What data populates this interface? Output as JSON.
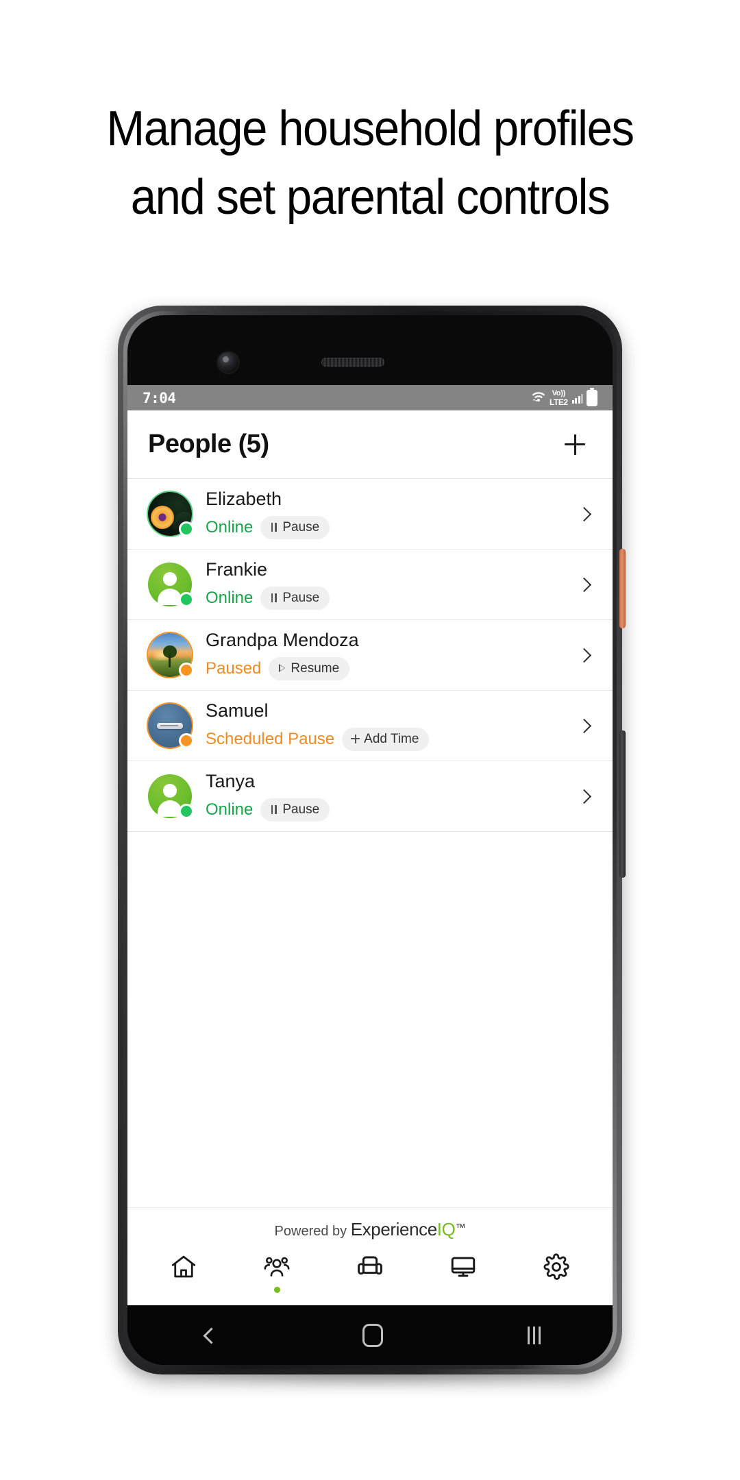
{
  "headline": {
    "line1": "Manage household profiles",
    "line2": "and set parental controls"
  },
  "statusbar": {
    "time": "7:04",
    "wifi_icon": "wifi-icon",
    "volte_top": "Vo))",
    "volte_bottom": "LTE2",
    "signal_icon": "signal-bars-icon",
    "battery_icon": "battery-full-icon"
  },
  "header": {
    "title": "People (5)",
    "add_icon": "plus-icon"
  },
  "people": [
    {
      "name": "Elizabeth",
      "status": "Online",
      "status_kind": "online",
      "action_label": "Pause",
      "action_icon": "pause-icon",
      "avatar_kind": "photo-flower",
      "avatar_ring": "green",
      "chevron_icon": "chevron-right-icon"
    },
    {
      "name": "Frankie",
      "status": "Online",
      "status_kind": "online",
      "action_label": "Pause",
      "action_icon": "pause-icon",
      "avatar_kind": "default-person",
      "avatar_ring": "none",
      "chevron_icon": "chevron-right-icon"
    },
    {
      "name": "Grandpa Mendoza",
      "status": "Paused",
      "status_kind": "paused",
      "action_label": "Resume",
      "action_icon": "play-icon",
      "avatar_kind": "photo-landscape",
      "avatar_ring": "orange",
      "chevron_icon": "chevron-right-icon"
    },
    {
      "name": "Samuel",
      "status": "Scheduled Pause",
      "status_kind": "paused",
      "action_label": "Add Time",
      "action_icon": "plus-icon",
      "avatar_kind": "photo-blue",
      "avatar_ring": "orange",
      "chevron_icon": "chevron-right-icon"
    },
    {
      "name": "Tanya",
      "status": "Online",
      "status_kind": "online",
      "action_label": "Pause",
      "action_icon": "pause-icon",
      "avatar_kind": "default-person",
      "avatar_ring": "none",
      "chevron_icon": "chevron-right-icon"
    }
  ],
  "footer": {
    "powered_prefix": "Powered by ",
    "brand_main": "Experience",
    "brand_accent": "IQ",
    "brand_tm": "™",
    "tabs": [
      {
        "name": "home",
        "icon": "home-icon",
        "active": false
      },
      {
        "name": "people",
        "icon": "people-icon",
        "active": true
      },
      {
        "name": "places",
        "icon": "armchair-icon",
        "active": false
      },
      {
        "name": "devices",
        "icon": "monitor-icon",
        "active": false
      },
      {
        "name": "settings",
        "icon": "gear-icon",
        "active": false
      }
    ]
  },
  "android_nav": {
    "back_icon": "back-chevron-icon",
    "home_icon": "home-circle-icon",
    "recents_icon": "recents-bars-icon"
  },
  "colors": {
    "accent_green": "#76bc21",
    "status_online": "#17a54a",
    "status_paused": "#f08a22",
    "dot_online": "#22c55e",
    "dot_paused": "#f79421",
    "statusbar_bg": "#848484"
  }
}
